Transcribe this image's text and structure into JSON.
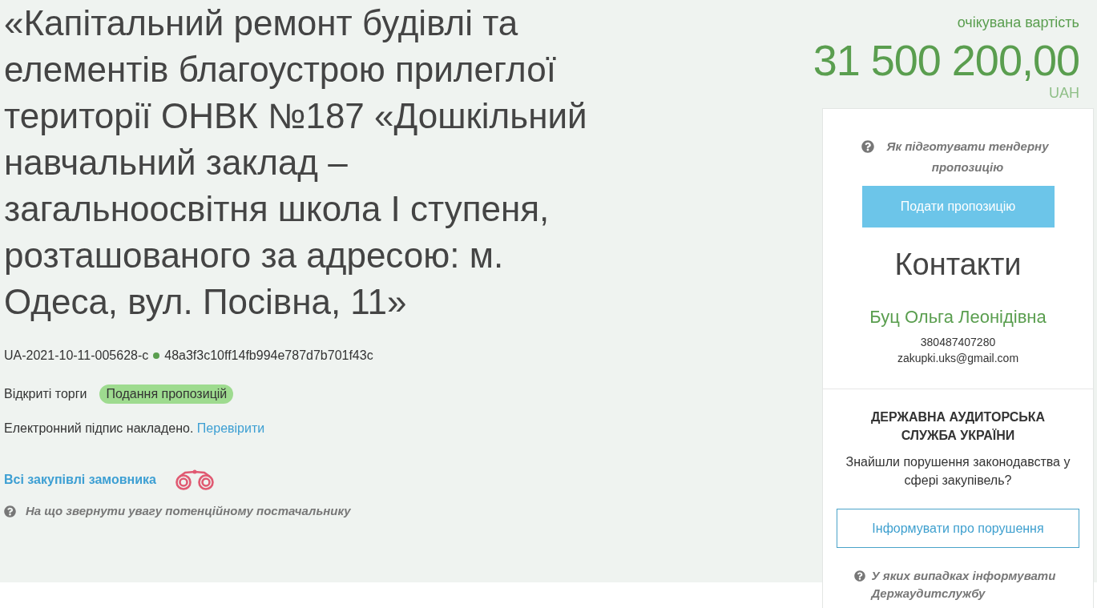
{
  "tender": {
    "title": "«Капітальний ремонт будівлі та елементів благоустрою прилеглої території ОНВК №187 «Дошкільний навчальний заклад – загальноосвітня школа І ступеня, розташованого за адресою: м. Одеса, вул. Посівна, 11»",
    "tender_id": "UA-2021-10-11-005628-c",
    "hash": "48a3f3c10ff14fb994e787d7b701f43c",
    "procedure_type": "Відкриті торги",
    "status": "Подання пропозицій",
    "signature": {
      "text": "Електронний підпис накладено.",
      "link": "Перевірити"
    },
    "buyer_link": "Всі закупівлі замовника",
    "supplier_help": "На що звернути увагу потенційному постачальнику"
  },
  "budget": {
    "label": "очікувана вартість",
    "amount": "31 500 200,00",
    "currency": "UAH"
  },
  "sidebar": {
    "bid_help": "Як підготувати тендерну пропозицію",
    "submit_button": "Подати пропозицію",
    "contacts": {
      "heading": "Контакти",
      "name": "Буц Ольга Леонідівна",
      "phone": "380487407280",
      "email": "zakupki.uks@gmail.com"
    },
    "audit": {
      "heading": "ДЕРЖАВНА АУДИТОРСЬКА СЛУЖБА УКРАЇНИ",
      "question": "Знайшли порушення законодавства у сфері закупівель?",
      "button": "Інформувати про порушення",
      "help": "У яких випадках інформувати Держаудитслужбу"
    }
  }
}
